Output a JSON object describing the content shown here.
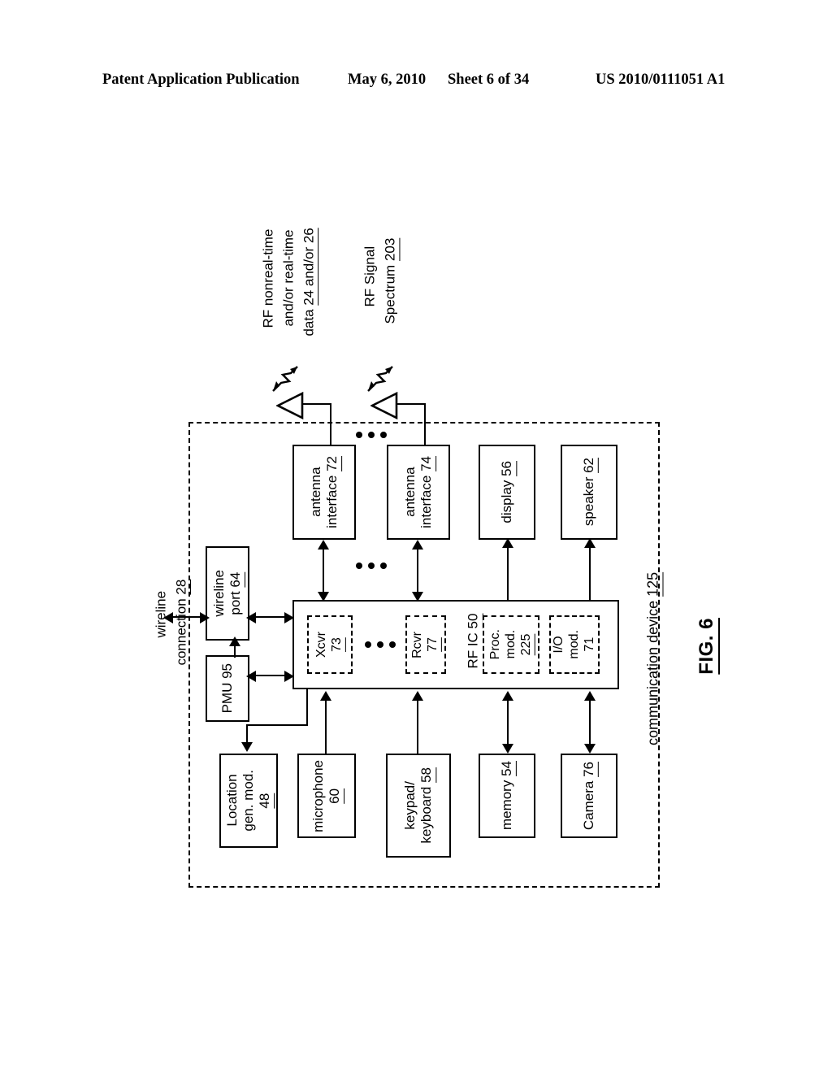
{
  "header": {
    "publication": "Patent Application Publication",
    "date": "May 6, 2010",
    "sheet": "Sheet 6 of 34",
    "number": "US 2010/0111051 A1"
  },
  "figure": {
    "caption": "FIG. 6",
    "device_label": "communication device 125",
    "device_label_text": "communication device ",
    "device_label_ref": "125"
  },
  "signals": [
    {
      "id": "rf-data-signal",
      "lines": [
        "RF nonreal-time",
        "and/or real-time",
        "data 24 and/or 26"
      ],
      "plain": "RF nonreal-time and/or real-time data 24 and/or 26",
      "icon": "rf-wave-icon"
    },
    {
      "id": "rf-spectrum-signal",
      "lines": [
        "RF Signal",
        "Spectrum 203"
      ],
      "plain": "RF Signal Spectrum 203",
      "icon": "rf-wave-icon"
    }
  ],
  "external": {
    "wireline_connection": "wireline connection 28",
    "wireline_connection_l1": "wireline",
    "wireline_connection_l2": "connection 28"
  },
  "blocks": {
    "antenna_interface_72": {
      "l1": "antenna",
      "l2": "interface 72",
      "ref": "72"
    },
    "antenna_interface_74": {
      "l1": "antenna",
      "l2": "interface 74",
      "ref": "74"
    },
    "display_56": {
      "l1": "display 56",
      "ref": "56"
    },
    "speaker_62": {
      "l1": "speaker 62",
      "ref": "62"
    },
    "wireline_port_64": {
      "l1": "wireline",
      "l2": "port 64",
      "ref": "64"
    },
    "pmu_95": {
      "l1": "PMU 95",
      "ref": "95"
    },
    "rf_ic_50": {
      "l1": "RF IC 50",
      "ref": "50"
    },
    "xcvr_73": {
      "l1": "Xcvr",
      "l2": "73",
      "ref": "73"
    },
    "rcvr_77": {
      "l1": "Rcvr",
      "l2": "77",
      "ref": "77"
    },
    "proc_mod_225": {
      "l1": "Proc.",
      "l2": "mod.",
      "l3": "225",
      "ref": "225"
    },
    "io_mod_71": {
      "l1": "I/O",
      "l2": "mod.",
      "l3": "71",
      "ref": "71"
    },
    "location_gen_mod_48": {
      "l1": "Location",
      "l2": "gen. mod.",
      "l3": "48",
      "ref": "48"
    },
    "microphone_60": {
      "l1": "microphone",
      "l2": "60",
      "ref": "60"
    },
    "keypad_keyboard_58": {
      "l1": "keypad/",
      "l2": "keyboard 58",
      "ref": "58"
    },
    "memory_54": {
      "l1": "memory 54",
      "ref": "54"
    },
    "camera_76": {
      "l1": "Camera 76",
      "ref": "76"
    }
  },
  "ellipses": {
    "antenna_row": "...",
    "interface_row": "...",
    "rfic_row": "..."
  }
}
